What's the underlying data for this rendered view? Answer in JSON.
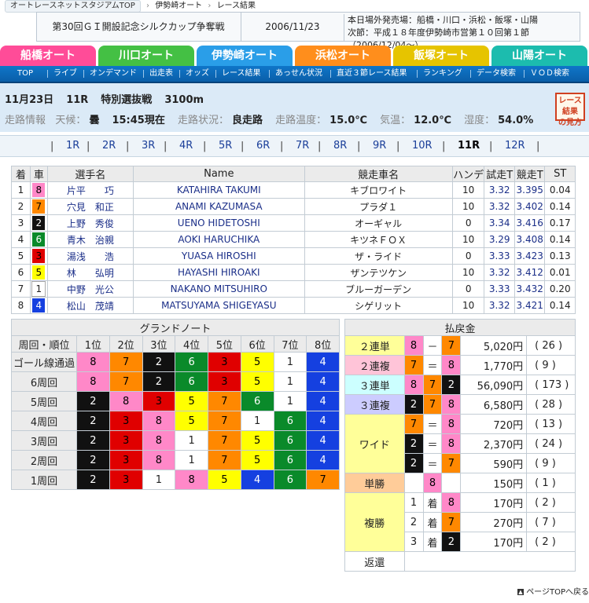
{
  "breadcrumb": [
    "オートレースネットスタジアムTOP",
    "伊勢崎オート",
    "レース結果"
  ],
  "event": {
    "title": "第30回ＧＩ開設記念シルクカップ争奪戦",
    "date": "2006/11/23",
    "info_line1": "本日場外発売場：船橋・川口・浜松・飯塚・山陽",
    "info_line2": "次節：平成１８年度伊勢崎市営第１０回第１節（2006/12/04～）"
  },
  "venue_tabs": [
    {
      "label": "船橋オート",
      "color": "#ff4c98"
    },
    {
      "label": "川口オート",
      "color": "#44c044"
    },
    {
      "label": "伊勢崎オート",
      "color": "#2a9ee8"
    },
    {
      "label": "浜松オート",
      "color": "#ff8e1c"
    },
    {
      "label": "飯塚オート",
      "color": "#e6c400"
    },
    {
      "label": "山陽オート",
      "color": "#1cbcae"
    }
  ],
  "subnav": [
    "TOP",
    "ライブ",
    "オンデマンド",
    "出走表",
    "オッズ",
    "レース結果",
    "あっせん状況",
    "直近３節レース結果",
    "ランキング",
    "データ検索",
    "ＶＯＤ検索"
  ],
  "race": {
    "date": "11月23日",
    "number": "11R",
    "name": "特別選抜戦",
    "distance": "3100m",
    "info_label": "走路情報",
    "weather_label": "天候：",
    "weather": "曇",
    "time": "15:45現在",
    "track_label": "走路状況：",
    "track": "良走路",
    "track_temp_label": "走路温度：",
    "track_temp": "15.0℃",
    "air_temp_label": "気温：",
    "air_temp": "12.0℃",
    "humidity_label": "湿度：",
    "humidity": "54.0%"
  },
  "result_badge": {
    "line1": "レース結果",
    "line2": "の見方"
  },
  "race_tabs": [
    "1R",
    "2R",
    "3R",
    "4R",
    "5R",
    "6R",
    "7R",
    "8R",
    "9R",
    "10R",
    "11R",
    "12R"
  ],
  "current_race": "11R",
  "entries_header": [
    "着",
    "車",
    "選手名",
    "Name",
    "競走車名",
    "ハンデ",
    "試走T",
    "競走T",
    "ST"
  ],
  "entries": [
    {
      "pos": "1",
      "car": "8",
      "name": "片平　　巧",
      "roman": "KATAHIRA TAKUMI",
      "machine": "キブロワイト",
      "handicap": "10",
      "trial": "3.32",
      "race": "3.395",
      "st": "0.04"
    },
    {
      "pos": "2",
      "car": "7",
      "name": "穴見　和正",
      "roman": "ANAMI KAZUMASA",
      "machine": "プラダ１",
      "handicap": "10",
      "trial": "3.32",
      "race": "3.402",
      "st": "0.14"
    },
    {
      "pos": "3",
      "car": "2",
      "name": "上野　秀俊",
      "roman": "UENO HIDETOSHI",
      "machine": "オーギャル",
      "handicap": "0",
      "trial": "3.34",
      "race": "3.416",
      "st": "0.17"
    },
    {
      "pos": "4",
      "car": "6",
      "name": "青木　治親",
      "roman": "AOKI HARUCHIKA",
      "machine": "キツネＦＯＸ",
      "handicap": "10",
      "trial": "3.29",
      "race": "3.408",
      "st": "0.14"
    },
    {
      "pos": "5",
      "car": "3",
      "name": "湯浅　　浩",
      "roman": "YUASA HIROSHI",
      "machine": "ザ・ライド",
      "handicap": "0",
      "trial": "3.33",
      "race": "3.423",
      "st": "0.13"
    },
    {
      "pos": "6",
      "car": "5",
      "name": "林　　弘明",
      "roman": "HAYASHI HIROAKI",
      "machine": "ザンテツケン",
      "handicap": "10",
      "trial": "3.32",
      "race": "3.412",
      "st": "0.01"
    },
    {
      "pos": "7",
      "car": "1",
      "name": "中野　光公",
      "roman": "NAKANO MITSUHIRO",
      "machine": "ブルーガーデン",
      "handicap": "0",
      "trial": "3.33",
      "race": "3.432",
      "st": "0.20"
    },
    {
      "pos": "8",
      "car": "4",
      "name": "松山　茂靖",
      "roman": "MATSUYAMA SHIGEYASU",
      "machine": "シゲリット",
      "handicap": "10",
      "trial": "3.32",
      "race": "3.421",
      "st": "0.14"
    }
  ],
  "grand_note": {
    "title": "グランドノート",
    "header": [
      "周回・順位",
      "1位",
      "2位",
      "3位",
      "4位",
      "5位",
      "6位",
      "7位",
      "8位"
    ],
    "rows": [
      {
        "label": "ゴール線通過",
        "cars": [
          "8",
          "7",
          "2",
          "6",
          "3",
          "5",
          "1",
          "4"
        ]
      },
      {
        "label": "6周回",
        "cars": [
          "8",
          "7",
          "2",
          "6",
          "3",
          "5",
          "1",
          "4"
        ]
      },
      {
        "label": "5周回",
        "cars": [
          "2",
          "8",
          "3",
          "5",
          "7",
          "6",
          "1",
          "4"
        ]
      },
      {
        "label": "4周回",
        "cars": [
          "2",
          "3",
          "8",
          "5",
          "7",
          "1",
          "6",
          "4"
        ]
      },
      {
        "label": "3周回",
        "cars": [
          "2",
          "3",
          "8",
          "1",
          "7",
          "5",
          "6",
          "4"
        ]
      },
      {
        "label": "2周回",
        "cars": [
          "2",
          "3",
          "8",
          "1",
          "7",
          "5",
          "6",
          "4"
        ]
      },
      {
        "label": "1周回",
        "cars": [
          "2",
          "3",
          "1",
          "8",
          "5",
          "4",
          "6",
          "7"
        ]
      }
    ]
  },
  "car_colors": {
    "1": {
      "bg": "#ffffff",
      "fg": "#222222"
    },
    "2": {
      "bg": "#111111",
      "fg": "#ffffff"
    },
    "3": {
      "bg": "#e00000",
      "fg": "#000000"
    },
    "4": {
      "bg": "#1540e0",
      "fg": "#ffffff"
    },
    "5": {
      "bg": "#ffff00",
      "fg": "#000000"
    },
    "6": {
      "bg": "#0a8a2a",
      "fg": "#ffffff"
    },
    "7": {
      "bg": "#ff8800",
      "fg": "#000000"
    },
    "8": {
      "bg": "#ff88c8",
      "fg": "#000000"
    }
  },
  "payout": {
    "title": "払戻金",
    "rentan2": {
      "label": "２連単",
      "c1": "8",
      "sep": "－",
      "c2": "7",
      "amount": "5,020円",
      "pop": "( 26 )"
    },
    "renpuku2": {
      "label": "２連複",
      "c1": "7",
      "sep": "＝",
      "c2": "8",
      "amount": "1,770円",
      "pop": "( 9 )"
    },
    "rentan3": {
      "label": "３連単",
      "c1": "8",
      "c2": "7",
      "c3": "2",
      "amount": "56,090円",
      "pop": "( 173 )"
    },
    "renpuku3": {
      "label": "３連複",
      "c1": "2",
      "c2": "7",
      "c3": "8",
      "amount": "6,580円",
      "pop": "( 28 )"
    },
    "wide_label": "ワイド",
    "wide": [
      {
        "c1": "7",
        "sep": "＝",
        "c2": "8",
        "amount": "720円",
        "pop": "( 13 )"
      },
      {
        "c1": "2",
        "sep": "＝",
        "c2": "8",
        "amount": "2,370円",
        "pop": "( 24 )"
      },
      {
        "c1": "2",
        "sep": "＝",
        "c2": "7",
        "amount": "590円",
        "pop": "( 9 )"
      }
    ],
    "tansho": {
      "label": "単勝",
      "c1": "8",
      "amount": "150円",
      "pop": "( 1 )"
    },
    "fukusho_label": "複勝",
    "fukusho": [
      {
        "rank": "1",
        "chaku": "着",
        "c1": "8",
        "amount": "170円",
        "pop": "( 2 )"
      },
      {
        "rank": "2",
        "chaku": "着",
        "c1": "7",
        "amount": "270円",
        "pop": "( 7 )"
      },
      {
        "rank": "3",
        "chaku": "着",
        "c1": "2",
        "amount": "170円",
        "pop": "( 2 )"
      }
    ],
    "henkan_label": "返還",
    "henkan_value": ""
  },
  "footer": {
    "page_top": "ページTOPへ戻る"
  },
  "bg_colors": {
    "rentan2": "#ffff99",
    "renpuku2": "#ffc4d8",
    "rentan3": "#ccffff",
    "renpuku3": "#ccccff",
    "wide": "#ffff99",
    "tansho": "#ffcc99",
    "fukusho": "#ffff99"
  }
}
